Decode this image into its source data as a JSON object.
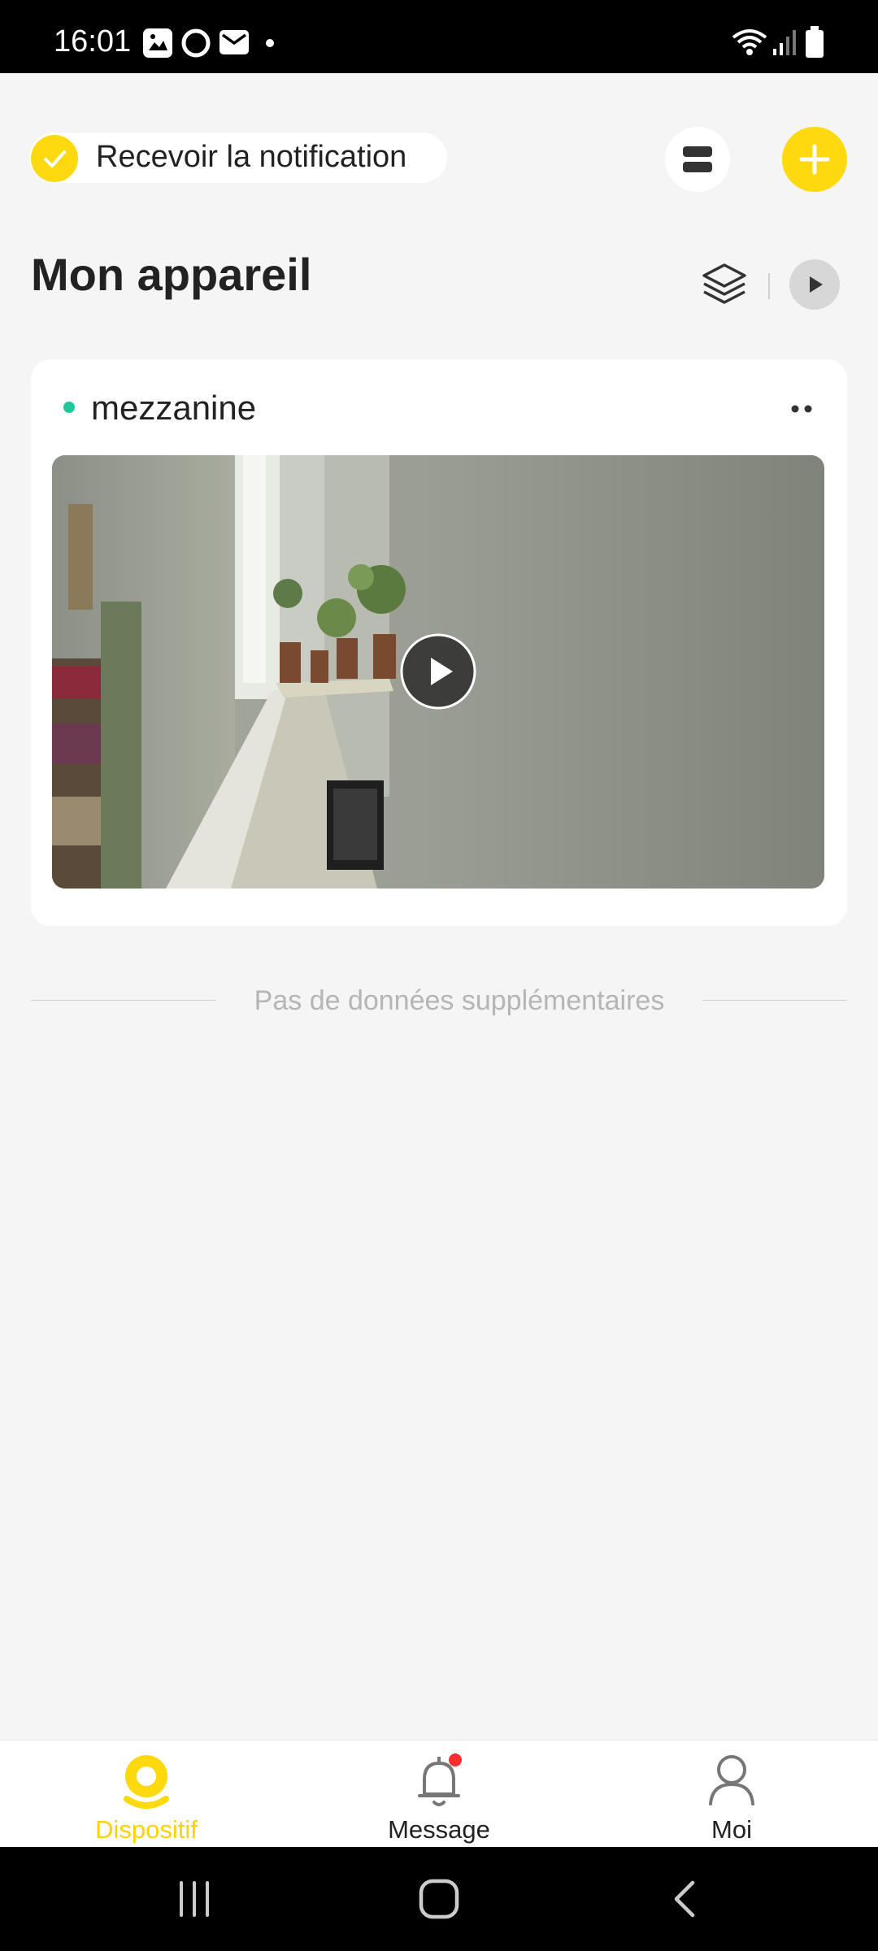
{
  "status_bar": {
    "time": "16:01",
    "left_icons": [
      "image-notification-icon",
      "circle-app-icon",
      "mail-icon",
      "dot-icon"
    ],
    "right_icons": [
      "wifi-icon",
      "signal-icon",
      "battery-icon"
    ]
  },
  "header": {
    "notification_label": "Recevoir la notification",
    "notification_checked": true,
    "menu_icon": "list-view-icon",
    "add_icon": "plus-icon"
  },
  "section": {
    "title": "Mon appareil",
    "layers_icon": "layers-icon",
    "play_icon": "play-icon"
  },
  "devices": [
    {
      "name": "mezzanine",
      "status": "online",
      "status_color": "#1fc79a",
      "more_icon": "more-dots-icon",
      "play_icon": "play-icon"
    }
  ],
  "list_end_text": "Pas de données supplémentaires",
  "tabs": [
    {
      "label": "Dispositif",
      "icon": "camera-device-icon",
      "active": true
    },
    {
      "label": "Message",
      "icon": "bell-icon",
      "active": false,
      "badge": true
    },
    {
      "label": "Moi",
      "icon": "user-icon",
      "active": false
    }
  ],
  "nav_bar": [
    "recent-apps-icon",
    "home-icon",
    "back-icon"
  ],
  "colors": {
    "accent": "#ffd90f",
    "background": "#f5f5f5",
    "card": "#ffffff",
    "online": "#1fc79a",
    "badge": "#ff2d2d"
  }
}
